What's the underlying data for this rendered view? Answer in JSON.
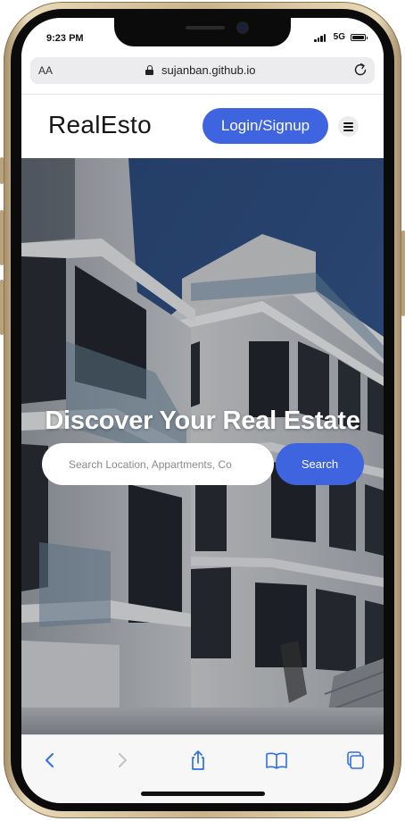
{
  "status_bar": {
    "time": "9:23 PM",
    "network": "5G"
  },
  "browser": {
    "text_size_label": "AA",
    "url": "sujanban.github.io"
  },
  "site": {
    "logo": "RealEsto",
    "login_label": "Login/Signup"
  },
  "hero": {
    "title": "Discover Your Real Estate",
    "search_placeholder": "Search Location, Appartments, Co",
    "search_button": "Search"
  },
  "colors": {
    "accent": "#3f64e0",
    "frame_gold": "#c9b48c"
  },
  "toolbar": {
    "icons": [
      "back-icon",
      "forward-icon",
      "share-icon",
      "bookmarks-icon",
      "tabs-icon"
    ]
  }
}
